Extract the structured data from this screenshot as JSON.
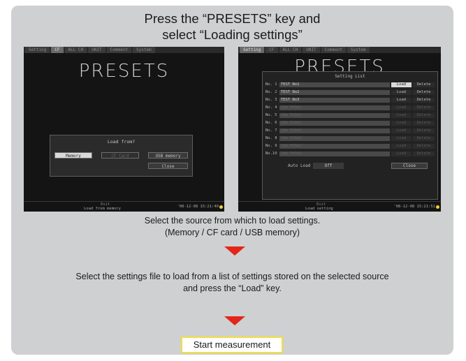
{
  "heading": {
    "line1": "Press the “PRESETS” key and",
    "line2": "select “Loading settings”"
  },
  "screen_left": {
    "tabs": [
      "Setting",
      "CF",
      "ALL CH",
      "UNIT",
      "Comment",
      "System"
    ],
    "active_tab": 1,
    "title": "PRESETS",
    "dialog": {
      "title": "Load from?",
      "options": [
        "Memory",
        "CF Card",
        "USB memory"
      ],
      "close": "Close"
    },
    "footer": {
      "top": "Exit",
      "bottom": "Load from memory",
      "time": "'08-12-08 15:21:40"
    }
  },
  "screen_right": {
    "tabs": [
      "Setting",
      "CF",
      "ALL CH",
      "UNIT",
      "Comment",
      "System"
    ],
    "active_tab": 0,
    "title": "PRESETS",
    "list": {
      "title": "Setting List",
      "rows": [
        {
          "no": "No. 1",
          "name": "TEST No1",
          "load": "Load",
          "delete": "Delete"
        },
        {
          "no": "No. 2",
          "name": "TEST No2",
          "load": "Load",
          "delete": "Delete"
        },
        {
          "no": "No. 3",
          "name": "TEST No3",
          "load": "Load",
          "delete": "Delete"
        },
        {
          "no": "No. 4",
          "name": "(no file)",
          "load": "Load",
          "delete": "Delete"
        },
        {
          "no": "No. 5",
          "name": "(no file)",
          "load": "Load",
          "delete": "Delete"
        },
        {
          "no": "No. 6",
          "name": "(no file)",
          "load": "Load",
          "delete": "Delete"
        },
        {
          "no": "No. 7",
          "name": "(no file)",
          "load": "Load",
          "delete": "Delete"
        },
        {
          "no": "No. 8",
          "name": "(no file)",
          "load": "Load",
          "delete": "Delete"
        },
        {
          "no": "No. 9",
          "name": "(no file)",
          "load": "Load",
          "delete": "Delete"
        },
        {
          "no": "No.10",
          "name": "(no file)",
          "load": "Load",
          "delete": "Delete"
        }
      ],
      "auto_load_label": "Auto Load",
      "auto_load_value": "Off",
      "close": "Close"
    },
    "footer": {
      "top": "Exit",
      "bottom": "Load setting",
      "time": "'08-12-08 15:21:51"
    }
  },
  "step1": {
    "line1": "Select the source from which to load settings.",
    "line2": "(Memory / CF card / USB memory)"
  },
  "step2": {
    "line1": "Select the settings file to load from a list of settings stored on the selected source",
    "line2": "and press the “Load” key."
  },
  "final_button": "Start measurement",
  "colors": {
    "panel": "#cfd0d2",
    "arrow": "#e32619",
    "button_border": "#f1e03a"
  }
}
